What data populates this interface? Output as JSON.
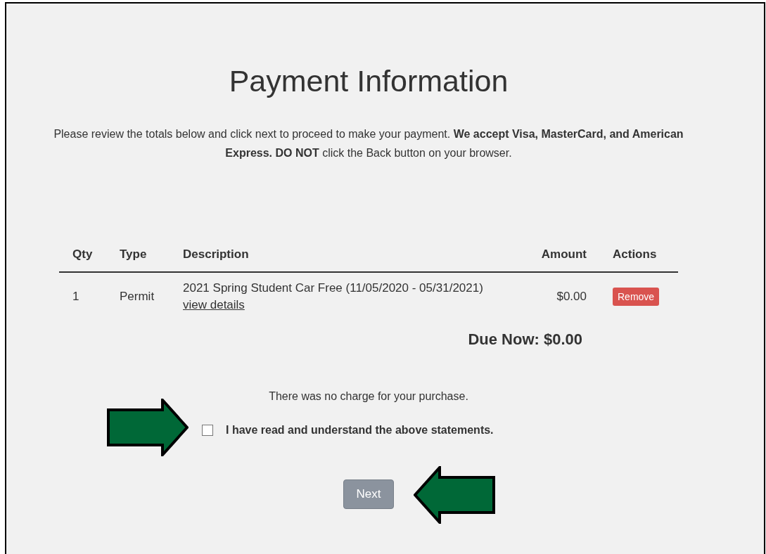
{
  "title": "Payment Information",
  "intro": "Please review the totals below and click next to proceed to make your payment. **We accept Visa, MasterCard, and American Express. DO NOT** click the Back button on your browser.",
  "table": {
    "columns": [
      "Qty",
      "Type",
      "Description",
      "Amount",
      "Actions"
    ],
    "rows": [
      {
        "qty": "1",
        "type": "Permit",
        "description": "2021 Spring Student Car Free (11/05/2020 - 05/31/2021)",
        "link": "view details",
        "amount": "$0.00",
        "action": "Remove"
      }
    ]
  },
  "due_now": "Due Now: $0.00",
  "notice": "There was no charge for your purchase.",
  "agreement": {
    "label": "I have read and understand the above statements.",
    "checked": false
  },
  "next_button": {
    "label": "Next",
    "disabled": true
  },
  "annotations": [
    {
      "kind": "arrow",
      "flipped": false
    },
    {
      "kind": "arrow",
      "flipped": true
    }
  ]
}
